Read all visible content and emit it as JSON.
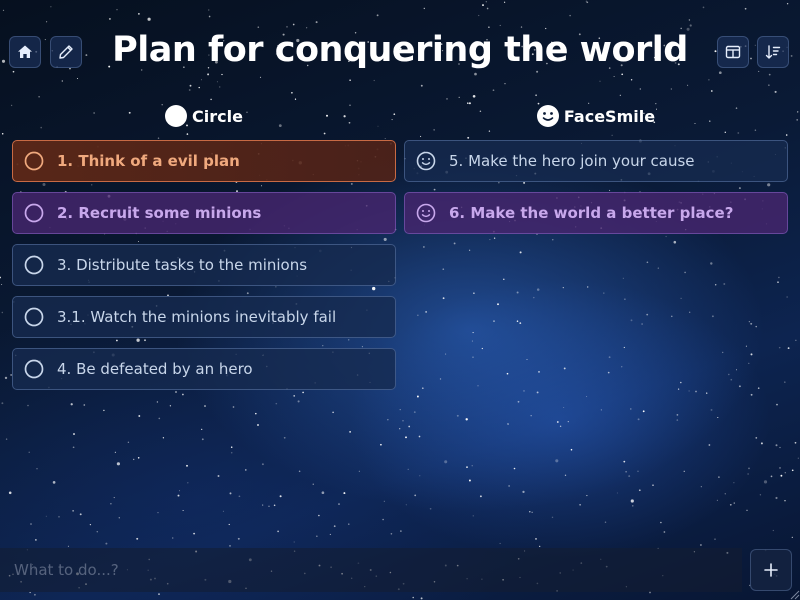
{
  "toolbar": {
    "home_icon": "home-icon",
    "edit_icon": "pencil-icon",
    "layout_icon": "columns-icon",
    "sort_icon": "sort-descending-icon"
  },
  "title": "Plan for conquering the world",
  "columns": [
    {
      "header": "Circle",
      "icon": "circle-icon",
      "items": [
        {
          "label": "1. Think of a evil plan",
          "style": "orange"
        },
        {
          "label": "2. Recruit some minions",
          "style": "purple"
        },
        {
          "label": "3. Distribute tasks to the minions",
          "style": "plain"
        },
        {
          "label": "3.1. Watch the minions inevitably fail",
          "style": "plain"
        },
        {
          "label": "4. Be defeated by an hero",
          "style": "plain"
        }
      ]
    },
    {
      "header": "FaceSmile",
      "icon": "face-smile-icon",
      "items": [
        {
          "label": "5. Make the hero join your cause",
          "style": "plain"
        },
        {
          "label": "6. Make the world a better place?",
          "style": "purple"
        }
      ]
    }
  ],
  "input": {
    "placeholder": "What to do...?",
    "value": ""
  },
  "add_button": {
    "icon": "plus-icon"
  },
  "colors": {
    "orange_accent": "#f0a97e",
    "purple_accent": "#c8a8ec",
    "plain_icon": "#c8d6ea"
  }
}
